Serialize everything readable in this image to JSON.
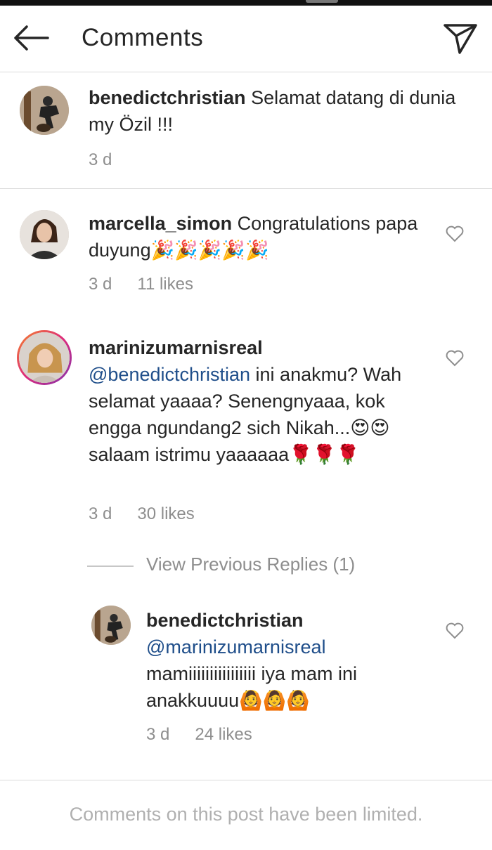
{
  "header": {
    "title": "Comments",
    "back_icon": "arrow-left-icon",
    "send_icon": "send-icon"
  },
  "comments": [
    {
      "username": "benedictchristian",
      "text": " Selamat datang di dunia my Özil !!!",
      "time": "3 d",
      "likes": ""
    },
    {
      "username": "marcella_simon",
      "text": " Congratulations papa duyung🎉🎉🎉🎉🎉",
      "time": "3 d",
      "likes": "11 likes"
    },
    {
      "username": "marinizumarnisreal",
      "mention": "@benedictchristian",
      "text": " ini anakmu? Wah selamat yaaaa? Senengnyaaa, kok engga ngundang2 sich Nikah...😍😍 salaam istrimu yaaaaaa🌹🌹🌹",
      "time": "3 d",
      "likes": "30 likes"
    }
  ],
  "view_previous": "View Previous Replies (1)",
  "reply": {
    "username": "benedictchristian",
    "mention": "@marinizumarnisreal",
    "text": "mamiiiiiiiiiiiiiiii iya mam ini anakkuuuu🙆🙆🙆",
    "time": "3 d",
    "likes": "24 likes"
  },
  "footer": {
    "limited_note": "Comments on this post have been limited."
  }
}
